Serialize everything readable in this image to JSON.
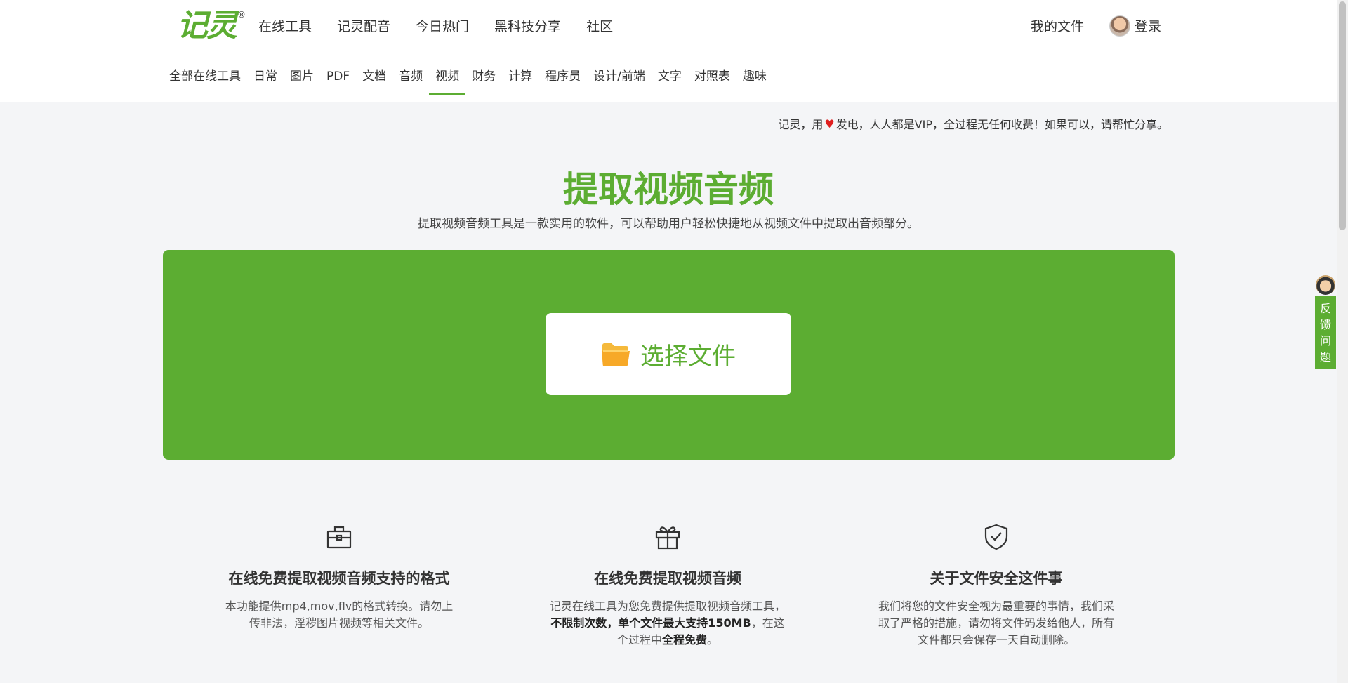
{
  "header": {
    "logo_text": "记灵",
    "logo_reg": "®",
    "nav": [
      "在线工具",
      "记灵配音",
      "今日热门",
      "黑科技分享",
      "社区"
    ],
    "my_files": "我的文件",
    "login": "登录"
  },
  "categories": {
    "items": [
      "全部在线工具",
      "日常",
      "图片",
      "PDF",
      "文档",
      "音频",
      "视频",
      "财务",
      "计算",
      "程序员",
      "设计/前端",
      "文字",
      "对照表",
      "趣味"
    ],
    "active": "视频"
  },
  "slogan": {
    "before": "记灵，用",
    "heart": "♥",
    "after": "发电，人人都是VIP，全过程无任何收费！如果可以，请帮忙分享。"
  },
  "page": {
    "title": "提取视频音频",
    "subtitle": "提取视频音频工具是一款实用的软件，可以帮助用户轻松快捷地从视频文件中提取出音频部分。"
  },
  "upload": {
    "button_label": "选择文件",
    "icon": "folder-icon"
  },
  "features": [
    {
      "icon": "toolbox-icon",
      "title": "在线免费提取视频音频支持的格式",
      "text": "本功能提供mp4,mov,flv的格式转换。请勿上传非法，淫秽图片视频等相关文件。"
    },
    {
      "icon": "gift-icon",
      "title": "在线免费提取视频音频",
      "text_1": "记灵在线工具为您免费提供提取视频音频工具，",
      "bold_1": "不限制次数，单个文件最大支持150MB",
      "text_2": "，在这个过程中",
      "bold_2": "全程免费",
      "text_3": "。"
    },
    {
      "icon": "shield-check-icon",
      "title": "关于文件安全这件事",
      "text": "我们将您的文件安全视为最重要的事情，我们采取了严格的措施，请勿将文件码发给他人，所有文件都只会保存一天自动删除。"
    }
  ],
  "feedback": {
    "label": "反馈问题"
  },
  "colors": {
    "brand_green": "#5cad32",
    "heart_red": "#e02020",
    "folder_yellow": "#f5b93b"
  }
}
